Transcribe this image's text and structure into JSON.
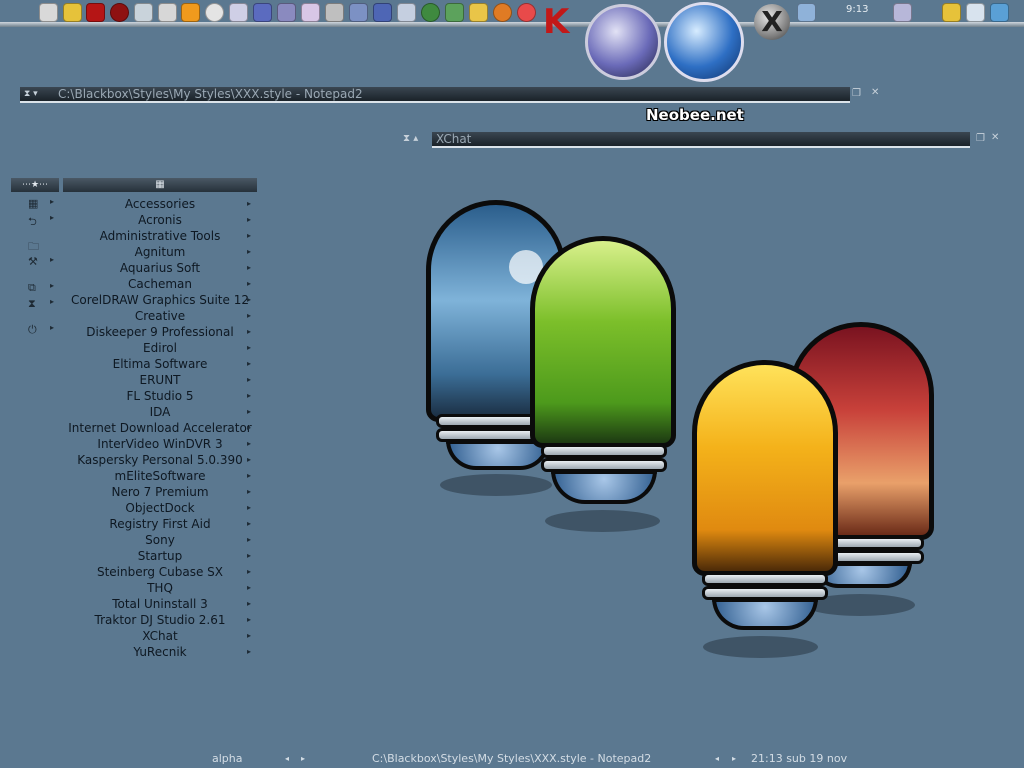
{
  "dock": {
    "clock": "9:13",
    "brand": "Neobee.net"
  },
  "notepad": {
    "title": "C:\\Blackbox\\Styles\\My Styles\\XXX.style - Notepad2"
  },
  "xchat": {
    "title": "XChat"
  },
  "menu": {
    "items": [
      {
        "label": "Accessories"
      },
      {
        "label": "Acronis"
      },
      {
        "label": "Administrative Tools"
      },
      {
        "label": "Agnitum"
      },
      {
        "label": "Aquarius Soft"
      },
      {
        "label": "Cacheman"
      },
      {
        "label": "CorelDRAW Graphics Suite 12"
      },
      {
        "label": "Creative"
      },
      {
        "label": "Diskeeper 9 Professional"
      },
      {
        "label": "Edirol"
      },
      {
        "label": "Eltima Software"
      },
      {
        "label": "ERUNT"
      },
      {
        "label": "FL Studio 5"
      },
      {
        "label": "IDA"
      },
      {
        "label": "Internet Download Accelerator"
      },
      {
        "label": "InterVideo WinDVR 3"
      },
      {
        "label": "Kaspersky Personal 5.0.390"
      },
      {
        "label": "mEliteSoftware"
      },
      {
        "label": "Nero 7 Premium"
      },
      {
        "label": "ObjectDock"
      },
      {
        "label": "Registry First Aid"
      },
      {
        "label": "Sony"
      },
      {
        "label": "Startup"
      },
      {
        "label": "Steinberg Cubase SX"
      },
      {
        "label": "THQ"
      },
      {
        "label": "Total Uninstall 3"
      },
      {
        "label": "Traktor DJ Studio 2.61"
      },
      {
        "label": "XChat"
      },
      {
        "label": "YuRecnik"
      }
    ]
  },
  "statusbar": {
    "workspace": "alpha",
    "window": "C:\\Blackbox\\Styles\\My Styles\\XXX.style - Notepad2",
    "datetime": "21:13 sub 19 nov"
  },
  "colors": {
    "desktop": "#5b7890",
    "accent_red": "#c21818",
    "globe_blue": "#2e6fc4"
  }
}
